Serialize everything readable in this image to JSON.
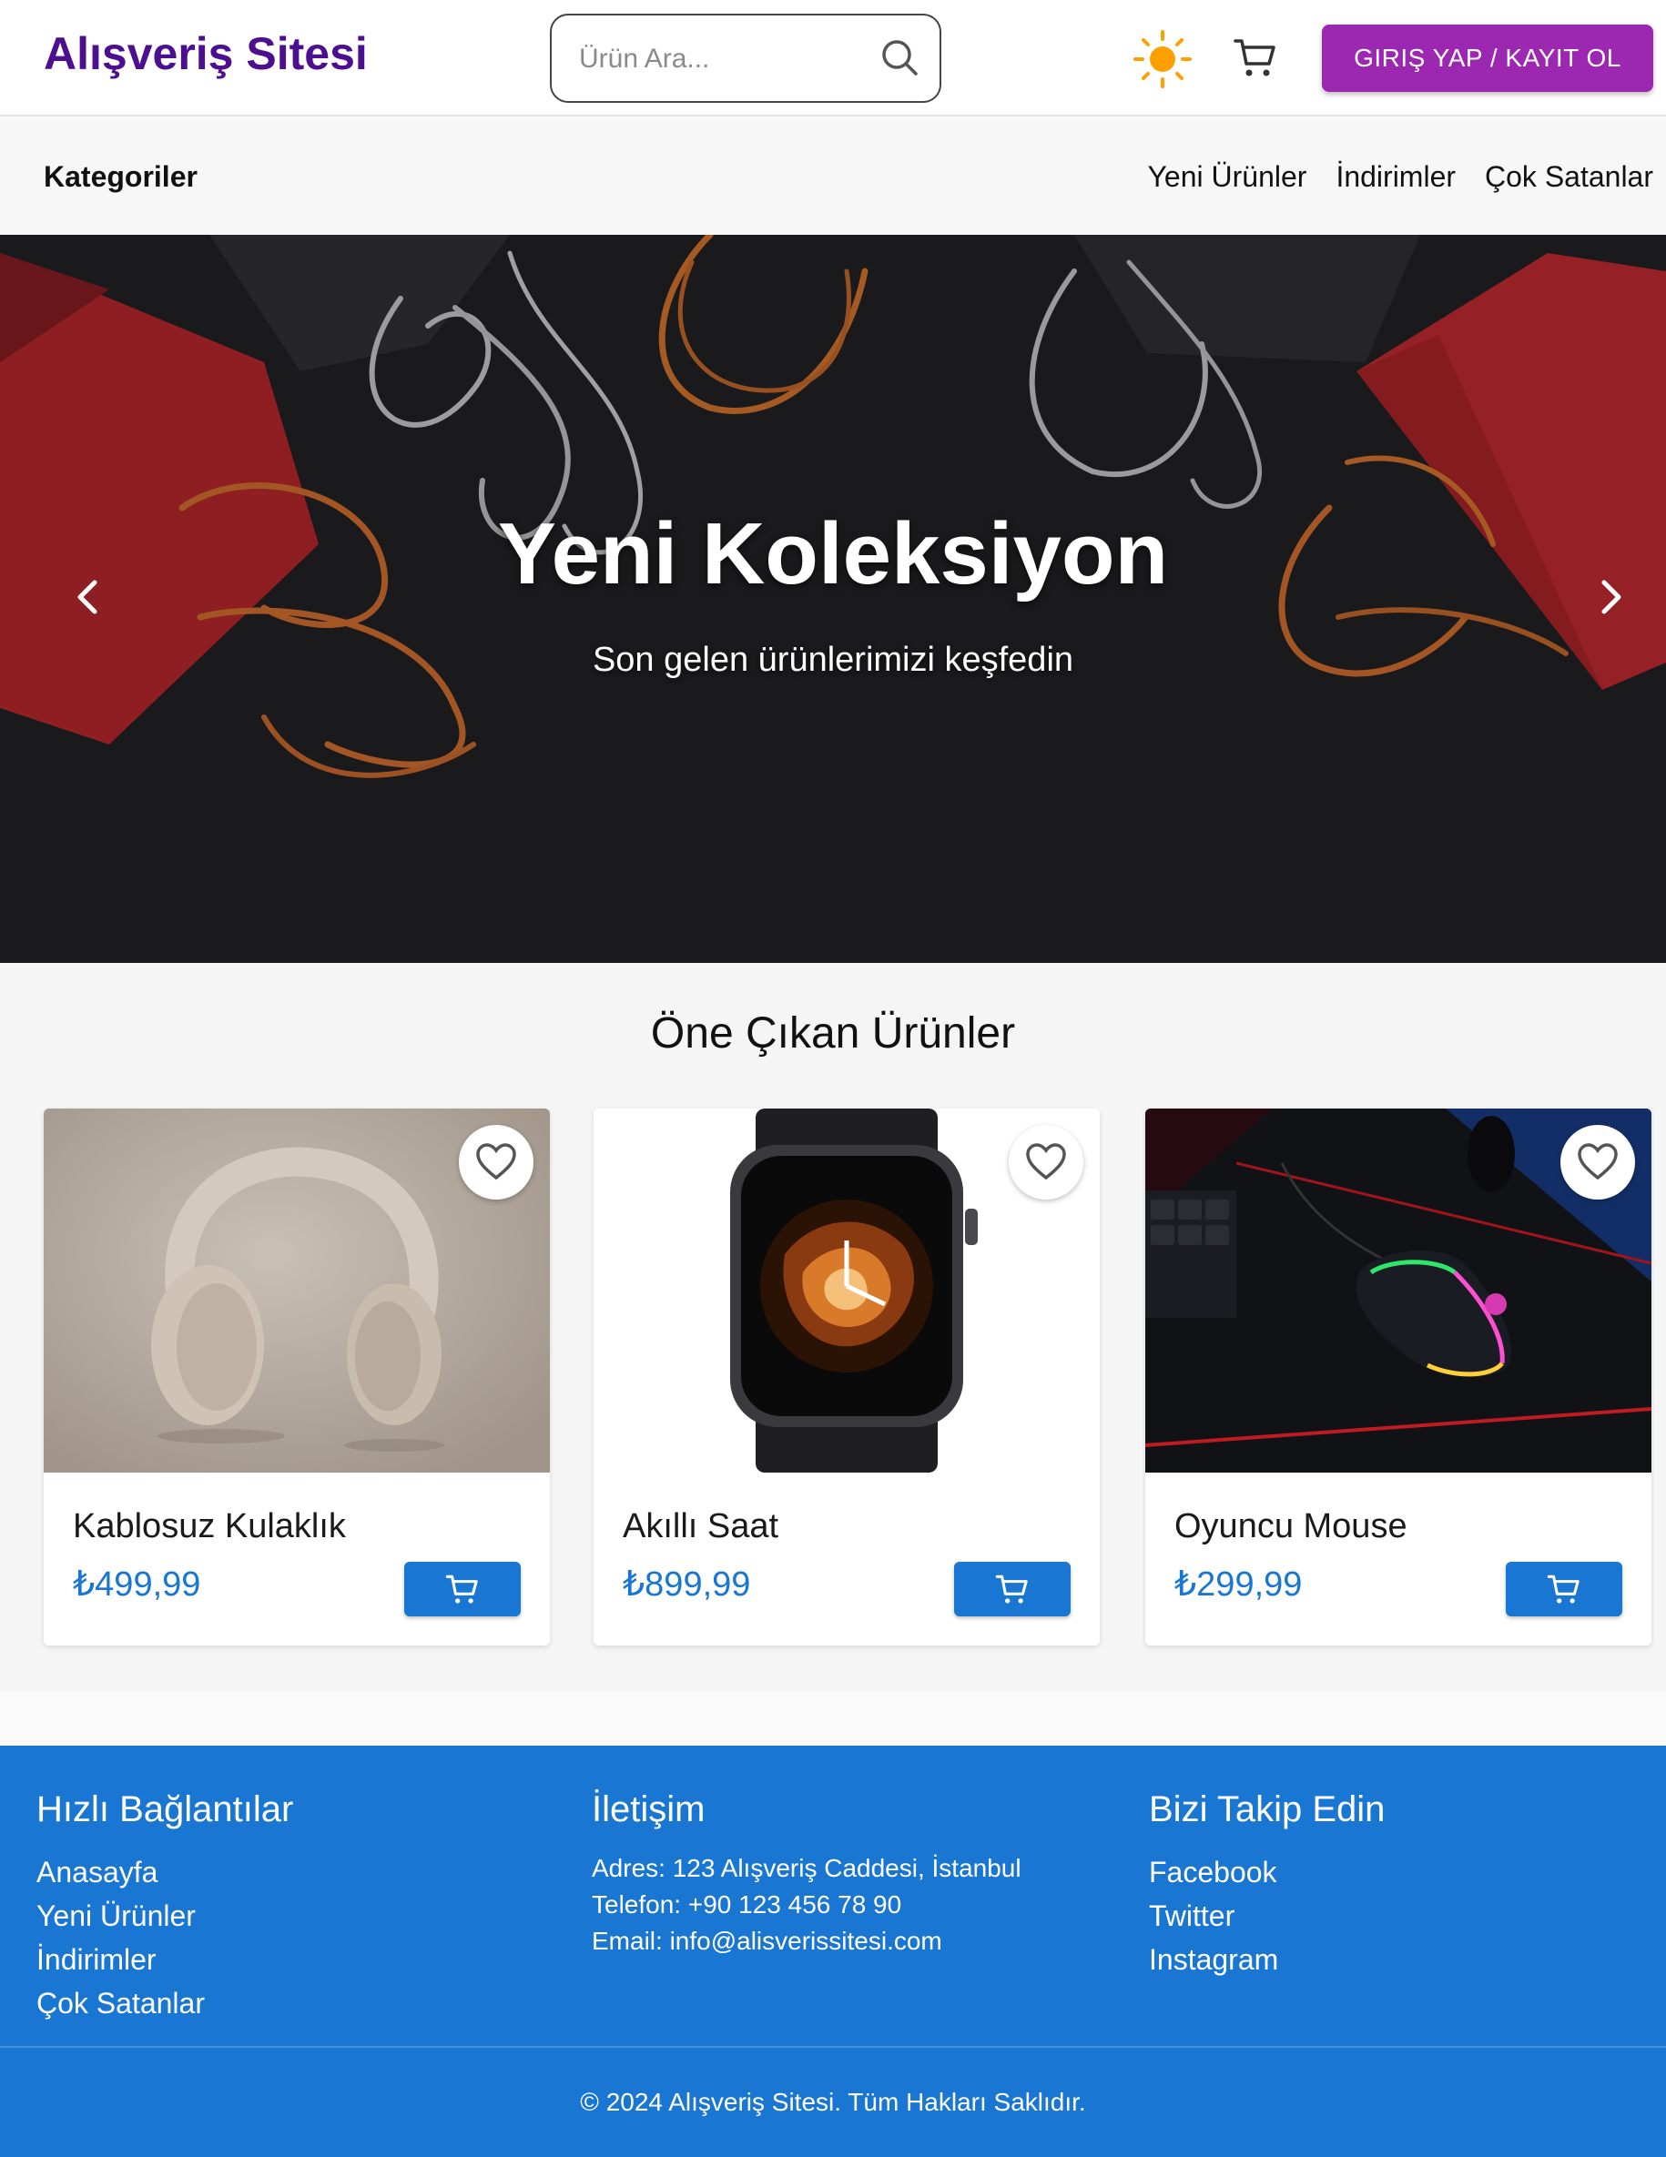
{
  "header": {
    "brand": "Alışveriş Sitesi",
    "search_placeholder": "Ürün Ara...",
    "login_label": "GIRIŞ YAP / KAYIT OL"
  },
  "nav": {
    "categories": "Kategoriler",
    "links": [
      "Yeni Ürünler",
      "İndirimler",
      "Çok Satanlar"
    ]
  },
  "hero": {
    "title": "Yeni Koleksiyon",
    "subtitle": "Son gelen ürünlerimizi keşfedin"
  },
  "featured": {
    "heading": "Öne Çıkan Ürünler",
    "products": [
      {
        "name": "Kablosuz Kulaklık",
        "price": "₺499,99",
        "image": "headphones"
      },
      {
        "name": "Akıllı Saat",
        "price": "₺899,99",
        "image": "smartwatch"
      },
      {
        "name": "Oyuncu Mouse",
        "price": "₺299,99",
        "image": "gaming-mouse"
      }
    ]
  },
  "footer": {
    "quick_links": {
      "heading": "Hızlı Bağlantılar",
      "items": [
        "Anasayfa",
        "Yeni Ürünler",
        "İndirimler",
        "Çok Satanlar"
      ]
    },
    "contact": {
      "heading": "İletişim",
      "address": "Adres: 123 Alışveriş Caddesi, İstanbul",
      "phone": "Telefon: +90 123 456 78 90",
      "email": "Email: info@alisverissitesi.com"
    },
    "social": {
      "heading": "Bizi Takip Edin",
      "items": [
        "Facebook",
        "Twitter",
        "Instagram"
      ]
    },
    "copyright": "© 2024 Alışveriş Sitesi. Tüm Hakları Saklıdır."
  },
  "colors": {
    "brand": "#4b0f8f",
    "login_button": "#9c27b0",
    "primary": "#1976d2",
    "theme_icon": "#ffa000"
  },
  "icons": [
    "search-icon",
    "sun-icon",
    "cart-icon",
    "chevron-left-icon",
    "chevron-right-icon",
    "heart-icon",
    "add-to-cart-icon"
  ]
}
